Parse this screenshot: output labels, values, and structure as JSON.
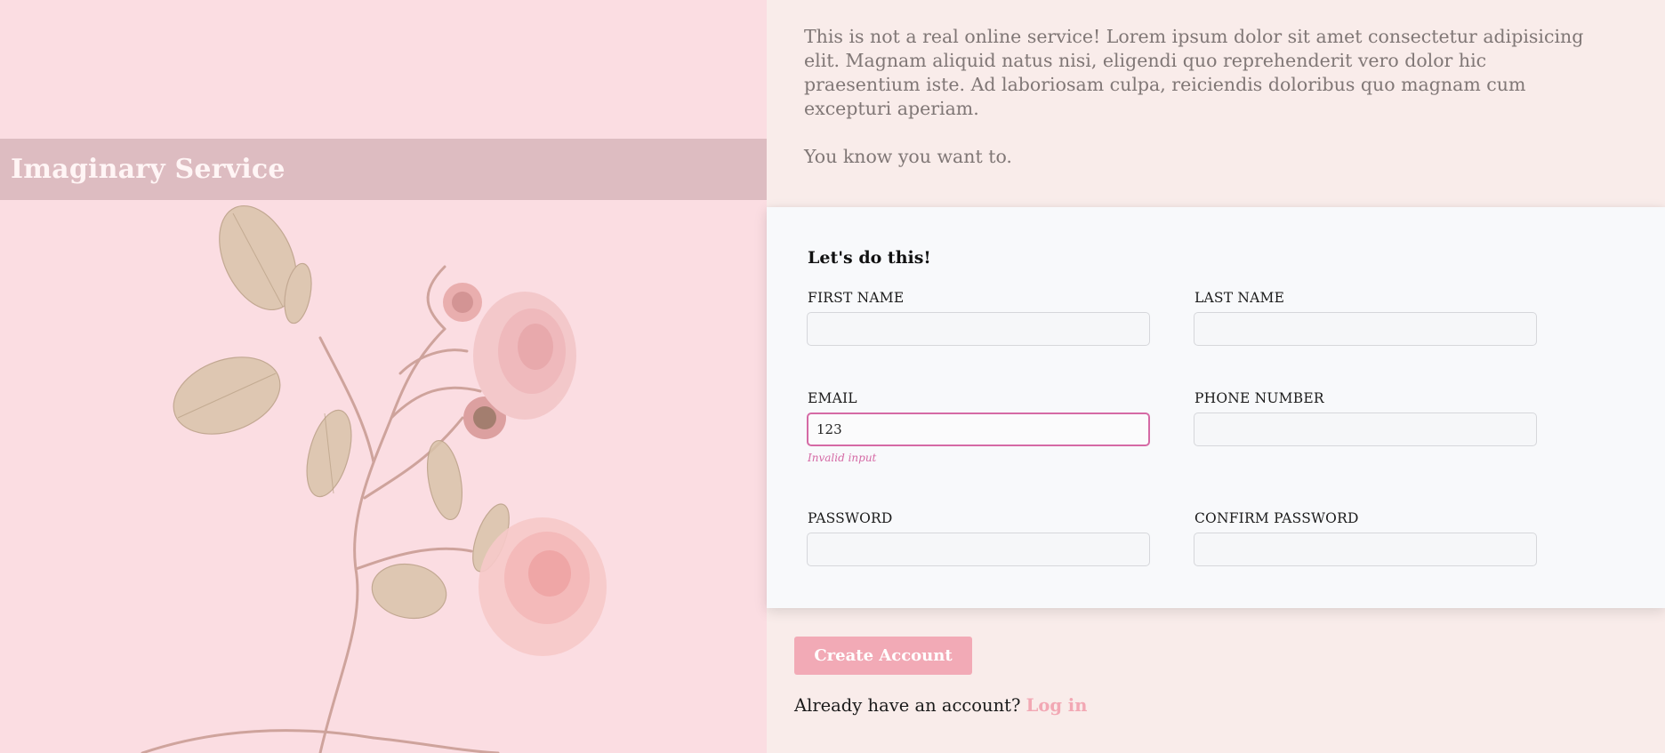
{
  "brand": {
    "title": "Imaginary Service"
  },
  "intro": {
    "paragraph": "This is not a real online service! Lorem ipsum dolor sit amet consectetur adipisicing elit. Magnam aliquid natus nisi, eligendi quo reprehenderit vero dolor hic praesentium iste. Ad laboriosam culpa, reiciendis doloribus quo magnam cum excepturi aperiam.",
    "tagline": "You know you want to."
  },
  "form": {
    "heading": "Let's do this!",
    "first_name": {
      "label": "FIRST NAME",
      "value": ""
    },
    "last_name": {
      "label": "LAST NAME",
      "value": ""
    },
    "email": {
      "label": "EMAIL",
      "value": "123",
      "error": "Invalid input"
    },
    "phone": {
      "label": "PHONE NUMBER",
      "value": ""
    },
    "password": {
      "label": "PASSWORD",
      "value": ""
    },
    "confirm_password": {
      "label": "CONFIRM PASSWORD",
      "value": ""
    }
  },
  "actions": {
    "create_account": "Create Account",
    "login_prompt": "Already have an account?",
    "login_link": "Log in"
  },
  "colors": {
    "hero_background": "#fbdde2",
    "page_background": "#f9ecea",
    "accent_pink": "#f2aab6",
    "error_magenta": "#d56aa5",
    "form_background": "#f8f9fb"
  },
  "icons": [
    "rose-illustration"
  ]
}
